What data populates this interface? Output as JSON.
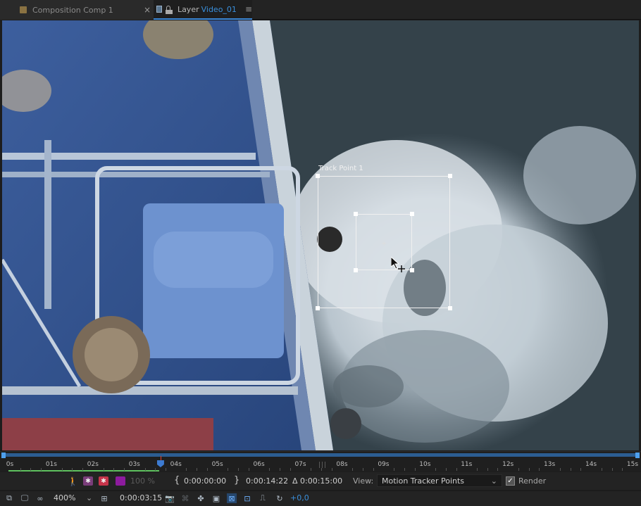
{
  "tabs": {
    "composition": {
      "label": "Composition Comp 1",
      "close": "×"
    },
    "layer": {
      "prefix": "Layer",
      "name": "Video_01",
      "menu": "≡"
    }
  },
  "viewer": {
    "track_point_label": "Track Point 1"
  },
  "timeline": {
    "ticks": [
      "0s",
      "01s",
      "02s",
      "03s",
      "04s",
      "05s",
      "06s",
      "07s",
      "08s",
      "09s",
      "10s",
      "11s",
      "12s",
      "13s",
      "14s",
      "15s"
    ],
    "playhead_time_sec": 3.63
  },
  "controls": {
    "opacity": "100 %",
    "in_point": "0:00:00:00",
    "out_point": "0:00:14:22",
    "duration": "Δ 0:00:15:00",
    "view_label": "View:",
    "view_value": "Motion Tracker Points",
    "render_label": "Render",
    "render_checked": true,
    "zoom": "400%",
    "current_time": "0:00:03:15",
    "exposure": "+0,0"
  },
  "colors": {
    "accent_blue": "#3a8fdb",
    "work_area": "#2c5d92",
    "cache_green": "#5fc35f",
    "playhead": "#3d7bd1"
  }
}
